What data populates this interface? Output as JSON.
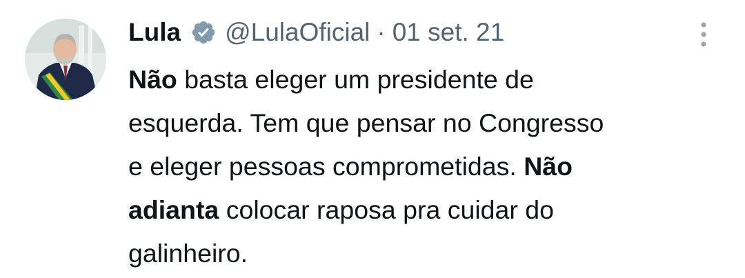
{
  "author": {
    "display_name": "Lula",
    "handle": "@LulaOficial",
    "verified_icon": "verified-badge-icon",
    "avatar_icon": "profile-photo"
  },
  "separator": "·",
  "date": "01 set. 21",
  "menu_icon": "more-vertical-icon",
  "tweet_text": {
    "l1_bold": "Não",
    "l1_rest": " basta eleger um presidente de",
    "l2": "esquerda. Tem que pensar no Congresso",
    "l3_rest": "e eleger pessoas comprometidas. ",
    "l3_bold": "Não",
    "l4_bold": "adianta",
    "l4_rest": " colocar raposa pra cuidar do",
    "l5": "galinheiro."
  },
  "colors": {
    "text": "#0f1419",
    "secondary": "#536471",
    "badge": "#829aab"
  }
}
